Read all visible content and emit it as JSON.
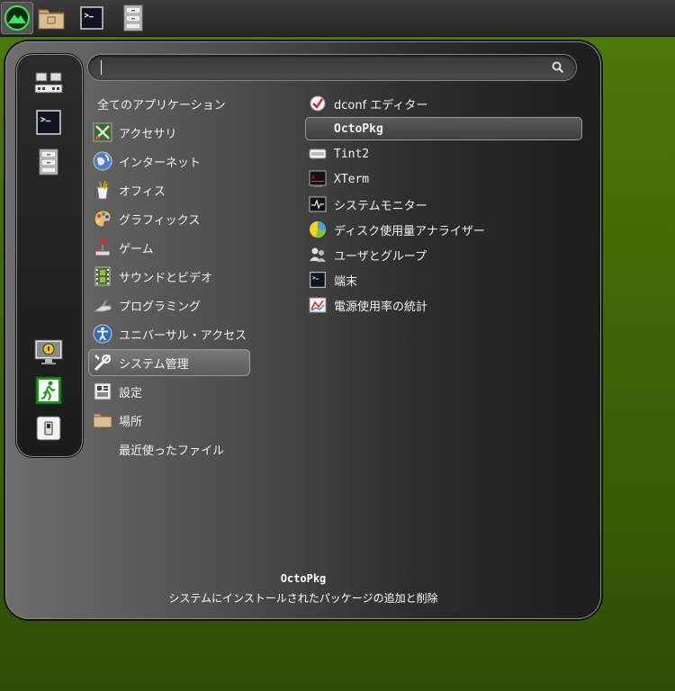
{
  "taskbar": {
    "launchers": [
      {
        "icon": "menu-logo-icon"
      },
      {
        "icon": "file-manager-icon"
      },
      {
        "icon": "terminal-icon"
      },
      {
        "icon": "file-cabinet-icon"
      }
    ]
  },
  "search": {
    "value": "",
    "placeholder": ""
  },
  "favorites": [
    {
      "icon": "network-devices-icon"
    },
    {
      "icon": "terminal-icon"
    },
    {
      "icon": "file-cabinet-icon"
    }
  ],
  "session": [
    {
      "icon": "lock-screen-icon"
    },
    {
      "icon": "logout-exit-icon"
    },
    {
      "icon": "shutdown-icon"
    }
  ],
  "categories": [
    {
      "label": "全てのアプリケーション",
      "icon": ""
    },
    {
      "label": "アクセサリ",
      "icon": "accessories-icon"
    },
    {
      "label": "インターネット",
      "icon": "internet-globe-icon"
    },
    {
      "label": "オフィス",
      "icon": "office-icon"
    },
    {
      "label": "グラフィックス",
      "icon": "graphics-palette-icon"
    },
    {
      "label": "ゲーム",
      "icon": "joystick-icon"
    },
    {
      "label": "サウンドとビデオ",
      "icon": "film-strip-icon"
    },
    {
      "label": "プログラミング",
      "icon": "programming-icon"
    },
    {
      "label": "ユニバーサル・アクセス",
      "icon": "accessibility-icon"
    },
    {
      "label": "システム管理",
      "icon": "tools-icon"
    },
    {
      "label": "設定",
      "icon": "settings-icon"
    },
    {
      "label": "場所",
      "icon": "folder-icon"
    },
    {
      "label": "最近使ったファイル",
      "icon": ""
    }
  ],
  "apps": [
    {
      "label": "dconf エディター",
      "icon": "dconf-icon"
    },
    {
      "label": "OctoPkg",
      "icon": "octopkg-icon"
    },
    {
      "label": "Tint2",
      "icon": "tint2-icon"
    },
    {
      "label": "XTerm",
      "icon": "xterm-icon"
    },
    {
      "label": "システムモニター",
      "icon": "system-monitor-icon"
    },
    {
      "label": "ディスク使用量アナライザー",
      "icon": "disk-usage-icon"
    },
    {
      "label": "ユーザとグループ",
      "icon": "users-groups-icon"
    },
    {
      "label": "端末",
      "icon": "terminal-icon"
    },
    {
      "label": "電源使用率の統計",
      "icon": "power-stats-icon"
    }
  ],
  "footer": {
    "title": "OctoPkg",
    "description": "システムにインストールされたパッケージの追加と削除"
  },
  "colors": {
    "accent": "#7bd400",
    "background": "#3f6808"
  }
}
